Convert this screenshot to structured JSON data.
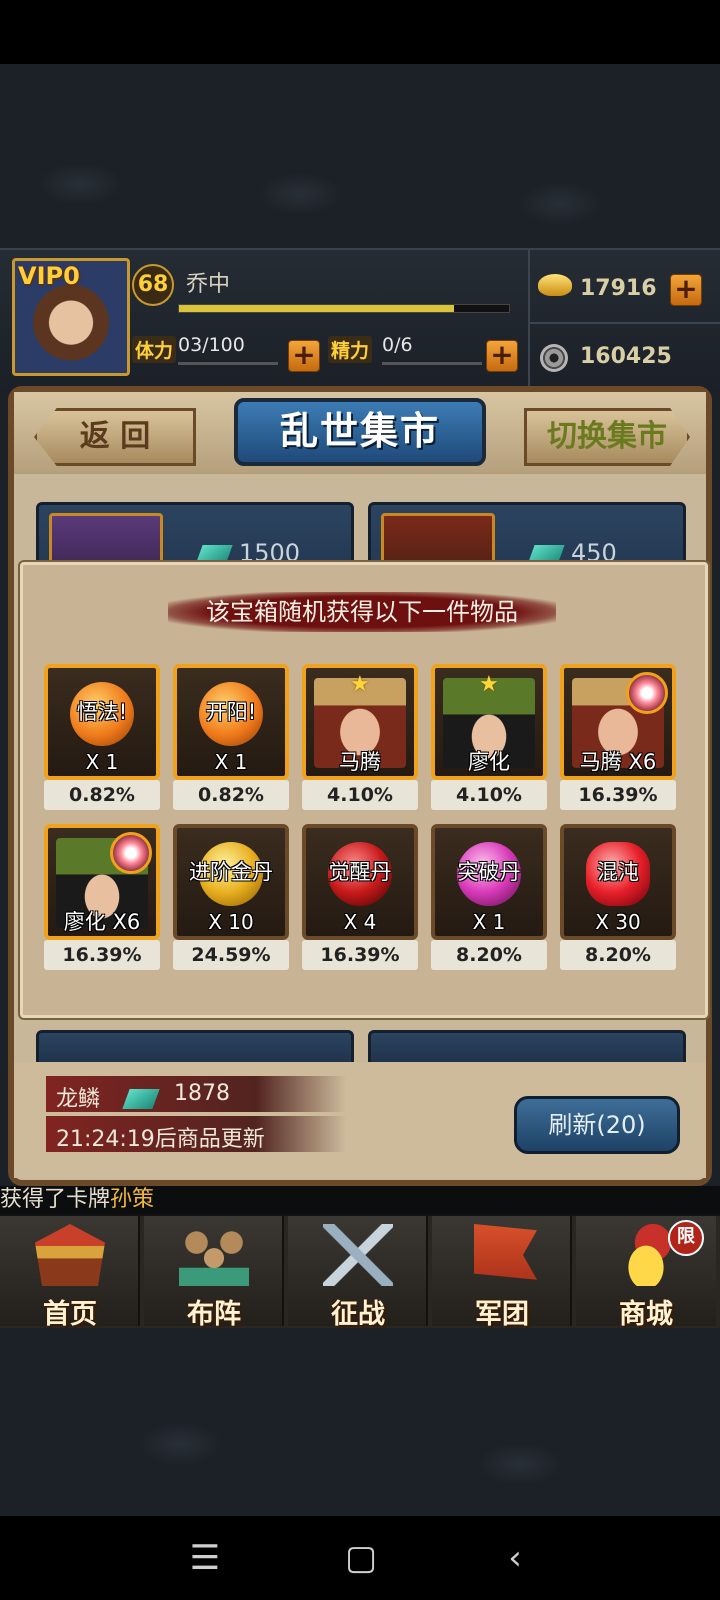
{
  "header": {
    "vip": "VIP0",
    "level": "68",
    "player_name": "乔中",
    "stamina_label": "体力",
    "stamina_value": "03/100",
    "energy_label": "精力",
    "energy_value": "0/6",
    "gold": "17916",
    "coins": "160425"
  },
  "market": {
    "back_label": "返 回",
    "title": "乱世集市",
    "switch_label": "切换集市",
    "cards": [
      {
        "price": "1500"
      },
      {
        "price": "450"
      }
    ]
  },
  "popup": {
    "title": "该宝箱随机获得以下一件物品",
    "items": [
      {
        "name": "悟法!",
        "qty": "X 1",
        "chance": "0.82%",
        "icon": "orange-seal-orb"
      },
      {
        "name": "开阳!",
        "qty": "X 1",
        "chance": "0.82%",
        "icon": "orange-seal-orb"
      },
      {
        "name": "马腾",
        "qty": "",
        "chance": "4.10%",
        "icon": "general-portrait"
      },
      {
        "name": "廖化",
        "qty": "",
        "chance": "4.10%",
        "icon": "general-portrait"
      },
      {
        "name": "马腾 X6",
        "qty": "",
        "chance": "16.39%",
        "icon": "general-fragment"
      },
      {
        "name": "廖化 X6",
        "qty": "",
        "chance": "16.39%",
        "icon": "general-fragment"
      },
      {
        "name": "进阶金丹",
        "qty": "X 10",
        "chance": "24.59%",
        "icon": "gold-pill"
      },
      {
        "name": "觉醒丹",
        "qty": "X 4",
        "chance": "16.39%",
        "icon": "red-pill"
      },
      {
        "name": "突破丹",
        "qty": "X 1",
        "chance": "8.20%",
        "icon": "pink-pill"
      },
      {
        "name": "混沌",
        "qty": "X 30",
        "chance": "8.20%",
        "icon": "red-gem"
      }
    ]
  },
  "bottom": {
    "dragon_label": "龙鳞",
    "dragon_value": "1878",
    "timer_text": "21:24:19后商品更新",
    "refresh_label": "刷新(20)"
  },
  "ticker": {
    "prefix": "获得了卡牌",
    "card_name": "孙策"
  },
  "nav": {
    "items": [
      {
        "label": "首页",
        "icon": "palace-icon"
      },
      {
        "label": "布阵",
        "icon": "chess-pieces-icon"
      },
      {
        "label": "征战",
        "icon": "crossed-swords-icon"
      },
      {
        "label": "军团",
        "icon": "war-banner-icon"
      },
      {
        "label": "商城",
        "icon": "treasure-icon"
      }
    ],
    "limited_badge": "限"
  },
  "colors": {
    "accent_gold": "#f0a21a",
    "title_blue": "#2f6aa0",
    "parchment": "#c8b494"
  }
}
